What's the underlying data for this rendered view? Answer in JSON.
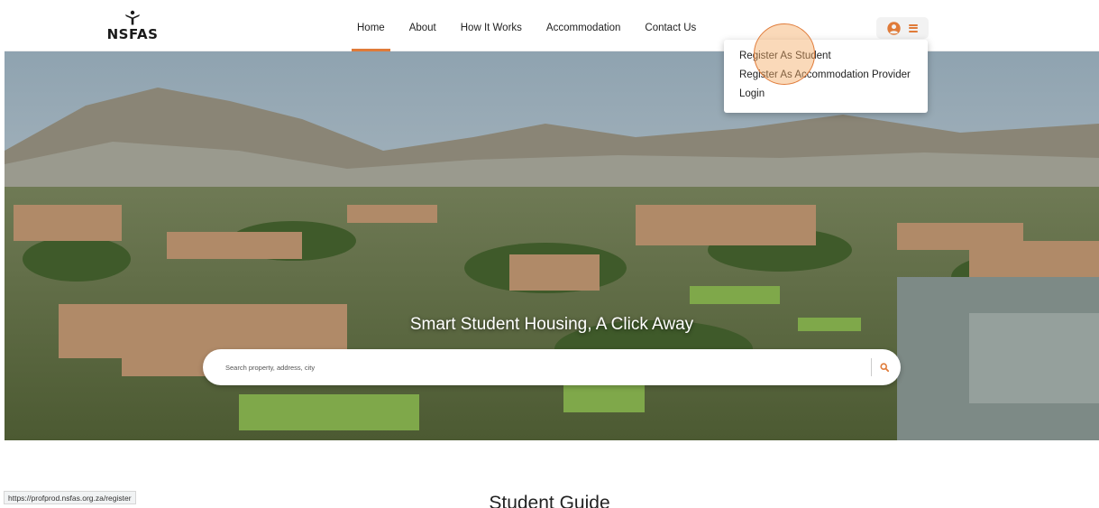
{
  "header": {
    "logo_text": "NSFAS",
    "nav": [
      {
        "label": "Home",
        "active": true
      },
      {
        "label": "About",
        "active": false
      },
      {
        "label": "How It Works",
        "active": false
      },
      {
        "label": "Accommodation",
        "active": false
      },
      {
        "label": "Contact Us",
        "active": false
      }
    ],
    "user_menu_icons": [
      "user-circle-icon",
      "hamburger-menu-icon"
    ]
  },
  "dropdown": {
    "items": [
      "Register As Student",
      "Register As Accommodation Provider",
      "Login"
    ]
  },
  "hero": {
    "title": "Smart Student Housing, A Click Away",
    "search": {
      "placeholder": "Search property, address, city",
      "value": "",
      "icon": "search-icon"
    }
  },
  "section": {
    "title": "Student Guide"
  },
  "status_bar": {
    "url": "https://profprod.nsfas.org.za/register"
  },
  "colors": {
    "accent": "#e07b39",
    "text": "#222222"
  }
}
